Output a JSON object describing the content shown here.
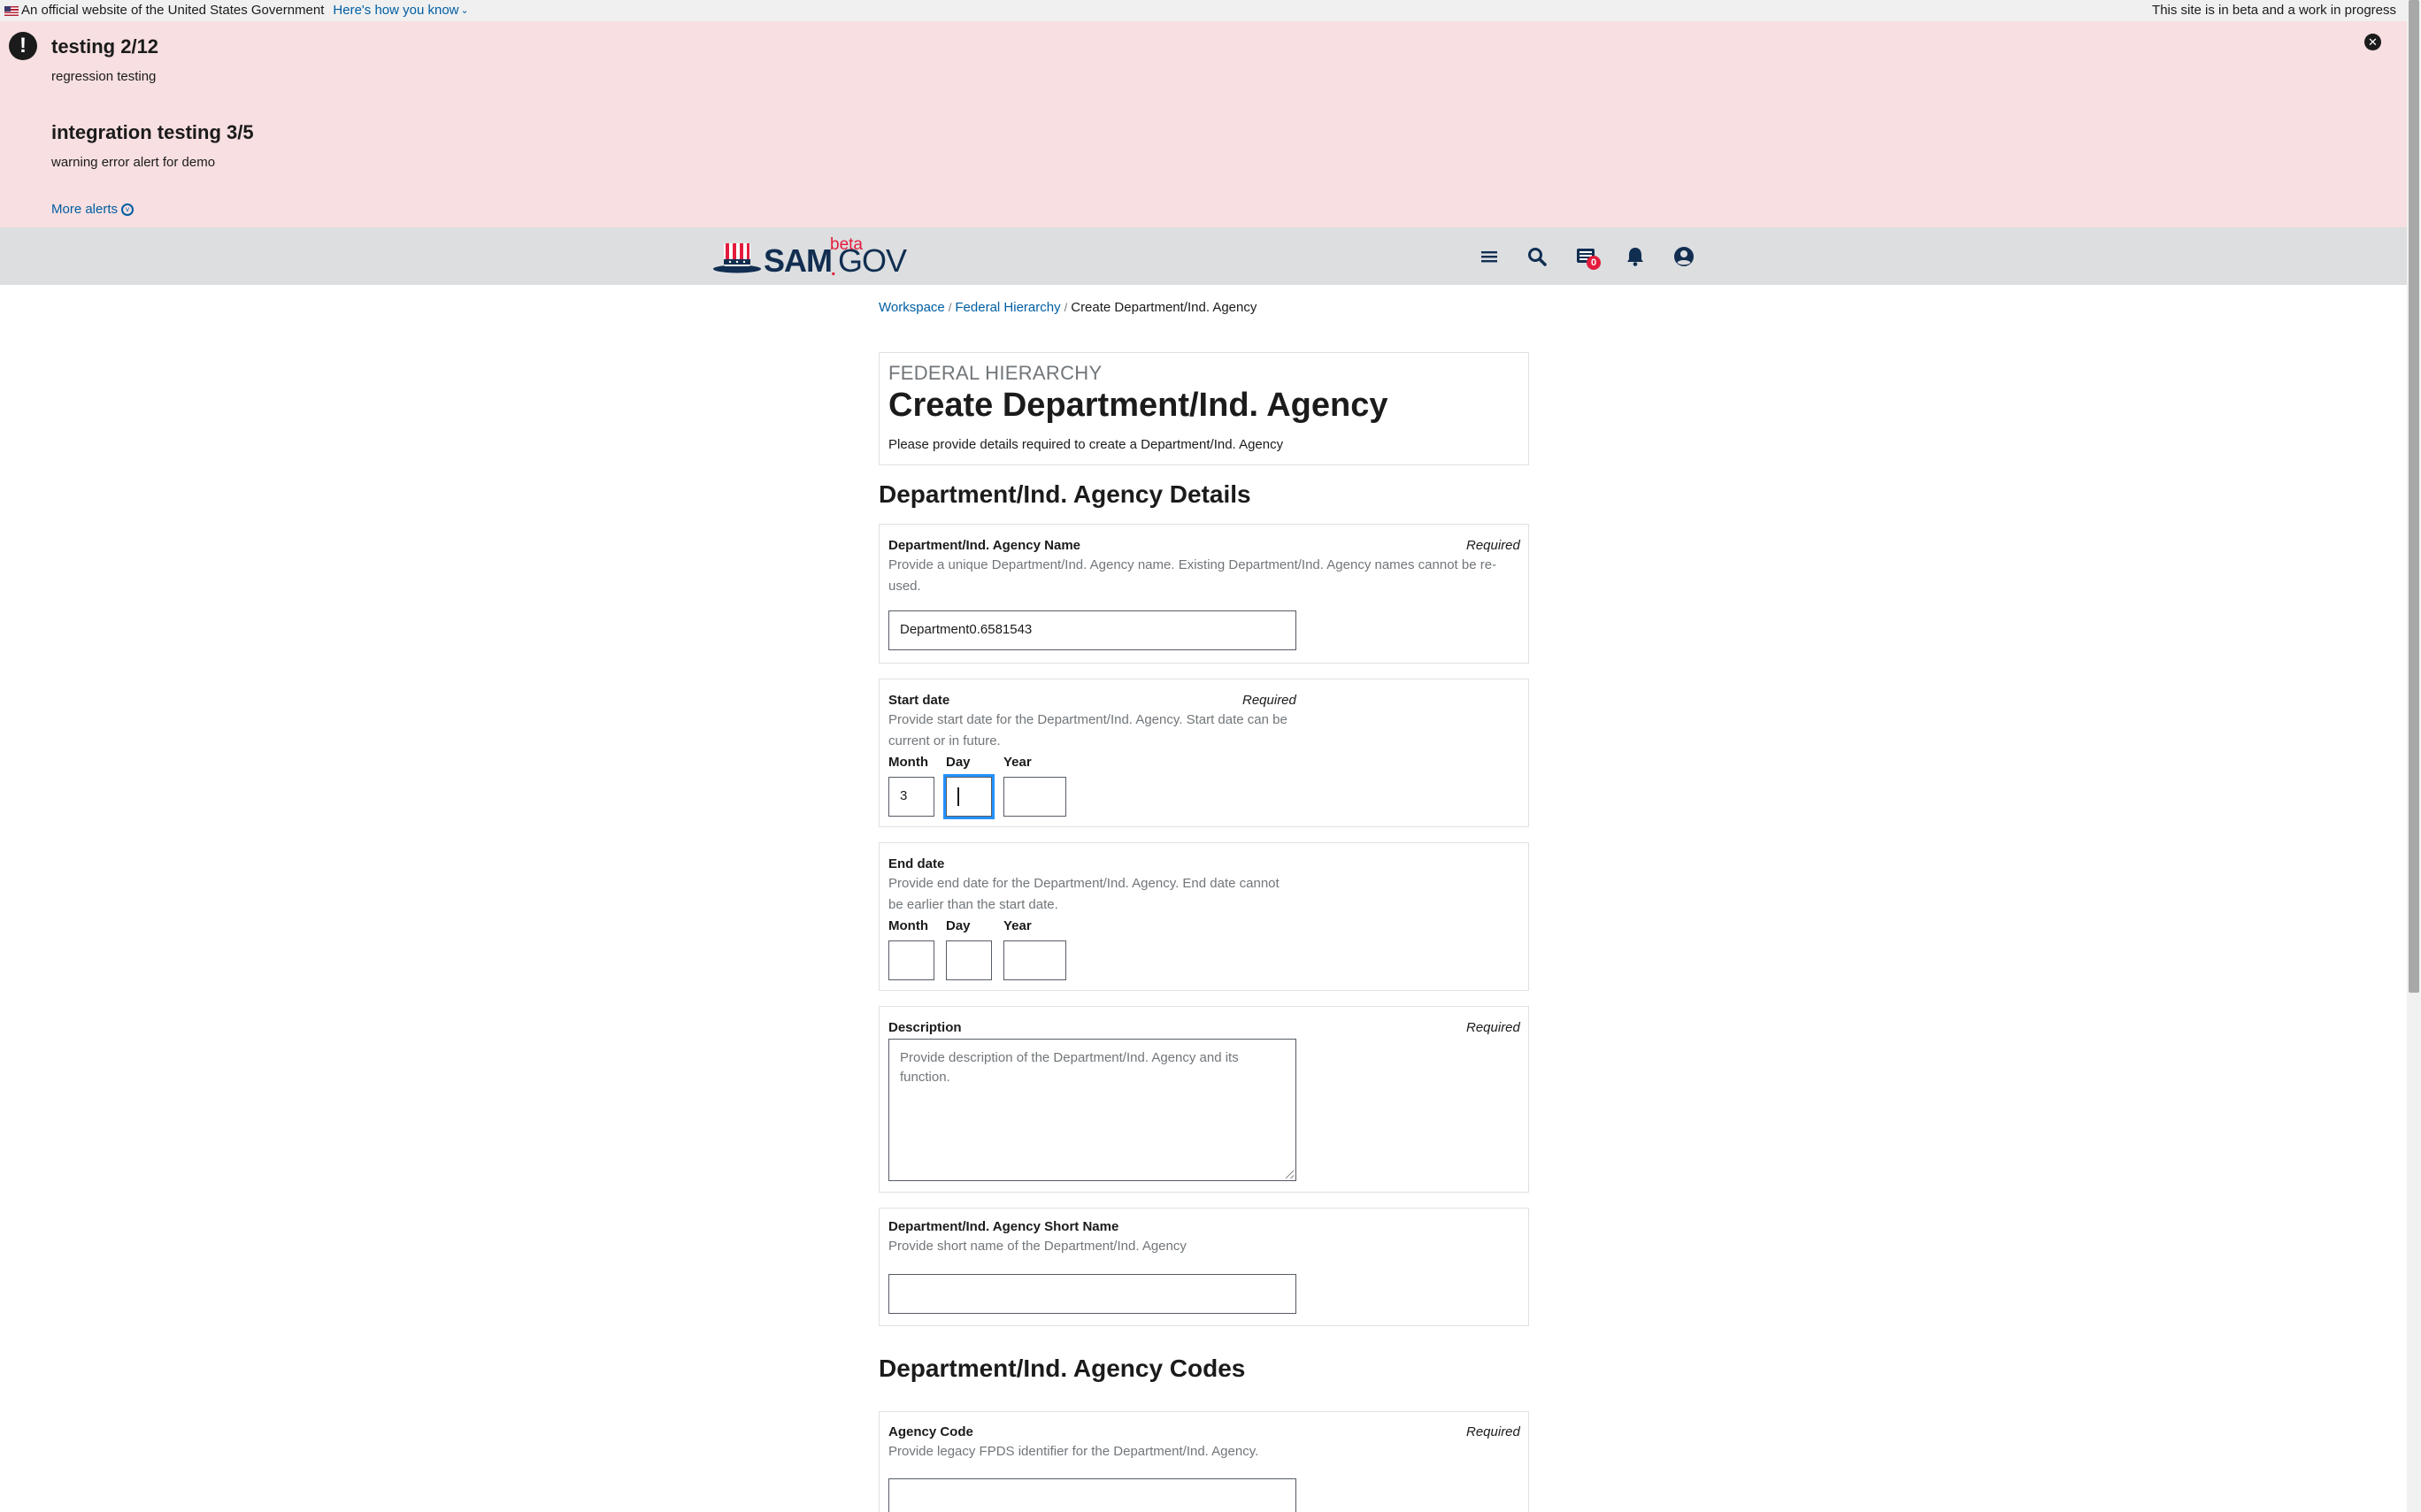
{
  "gov_banner": {
    "official_text": "An official website of the United States Government",
    "how_you_know": "Here's how you know",
    "beta_notice": "This site is in beta and a work in progress"
  },
  "alerts": {
    "items": [
      {
        "title": "testing 2/12",
        "body": "regression testing"
      },
      {
        "title": "integration testing 3/5",
        "body": "warning error alert for demo"
      }
    ],
    "more_label": "More alerts",
    "close_glyph": "✕"
  },
  "header": {
    "logo_sam": "SAM",
    "logo_dot": ".",
    "logo_gov": "GOV",
    "logo_beta": "beta",
    "icons": [
      "menu-icon",
      "search-icon",
      "messages-icon",
      "notifications-icon",
      "account-icon"
    ],
    "messages_badge": "0"
  },
  "breadcrumb": {
    "items": [
      "Workspace",
      "Federal Hierarchy"
    ],
    "separator": "/",
    "current": "Create Department/Ind. Agency"
  },
  "page": {
    "overline": "FEDERAL HIERARCHY",
    "title": "Create Department/Ind. Agency",
    "subtitle": "Please provide details required to create a Department/Ind. Agency"
  },
  "details_section": {
    "heading": "Department/Ind. Agency Details",
    "name_field": {
      "label": "Department/Ind. Agency Name",
      "required": "Required",
      "help_line1": "Provide a unique Department/Ind. Agency name. Existing Department/Ind. Agency names cannot be re-",
      "help_line2": "used.",
      "value": "Department0.6581543"
    },
    "start_date": {
      "label": "Start date",
      "required": "Required",
      "help_line1": "Provide start date for the Department/Ind. Agency. Start date can be",
      "help_line2": "current or in future.",
      "month_label": "Month",
      "day_label": "Day",
      "year_label": "Year",
      "month_value": "3",
      "day_value": "",
      "year_value": ""
    },
    "end_date": {
      "label": "End date",
      "help_line1": "Provide end date for the Department/Ind. Agency. End date cannot",
      "help_line2": "be earlier than the start date.",
      "month_label": "Month",
      "day_label": "Day",
      "year_label": "Year"
    },
    "description": {
      "label": "Description",
      "required": "Required",
      "placeholder_line1": "Provide description of the Department/Ind. Agency and its",
      "placeholder_line2": "function."
    },
    "short_name": {
      "label": "Department/Ind. Agency Short Name",
      "help": "Provide short name of the Department/Ind. Agency",
      "value": ""
    }
  },
  "codes_section": {
    "heading": "Department/Ind. Agency Codes",
    "agency_code": {
      "label": "Agency Code",
      "required": "Required",
      "help": "Provide legacy FPDS identifier for the Department/Ind. Agency.",
      "value": ""
    }
  },
  "colors": {
    "alert_bg": "#f8dfe1",
    "header_bg": "#dcdee0",
    "link": "#005ea2",
    "brand_navy": "#112e51",
    "brand_red": "#e31c3d",
    "focus": "#2491ff"
  }
}
